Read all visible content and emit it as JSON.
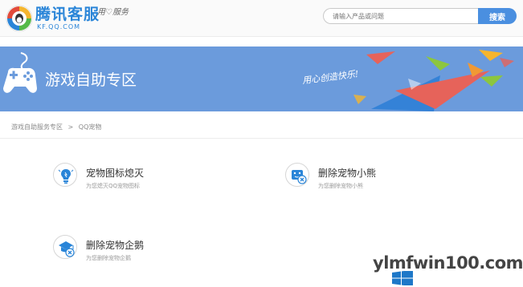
{
  "header": {
    "brand": "腾讯客服",
    "slogan": "用♡服务",
    "domain": "KF.QQ.COM",
    "search_placeholder": "请输入产品或问题",
    "search_button": "搜索"
  },
  "banner": {
    "title": "游戏自助专区",
    "slogan": "用心创造快乐!"
  },
  "breadcrumb": {
    "items": [
      "游戏自助服务专区",
      ">",
      "QQ宠物"
    ]
  },
  "tiles": [
    {
      "title": "宠物图标熄灭",
      "desc": "为您熄灭QQ宠物图标",
      "icon": "bulb-icon"
    },
    {
      "title": "删除宠物小熊",
      "desc": "为您删除宠物小熊",
      "icon": "delete-bear-icon"
    },
    {
      "title": "删除宠物企鹅",
      "desc": "为您删除宠物企鹅",
      "icon": "delete-penguin-icon"
    }
  ],
  "watermark": {
    "text": "ylmfwin100.com"
  },
  "colors": {
    "brand": "#2a85d8",
    "banner": "#6b9bdc",
    "button": "#4a8fe0"
  }
}
